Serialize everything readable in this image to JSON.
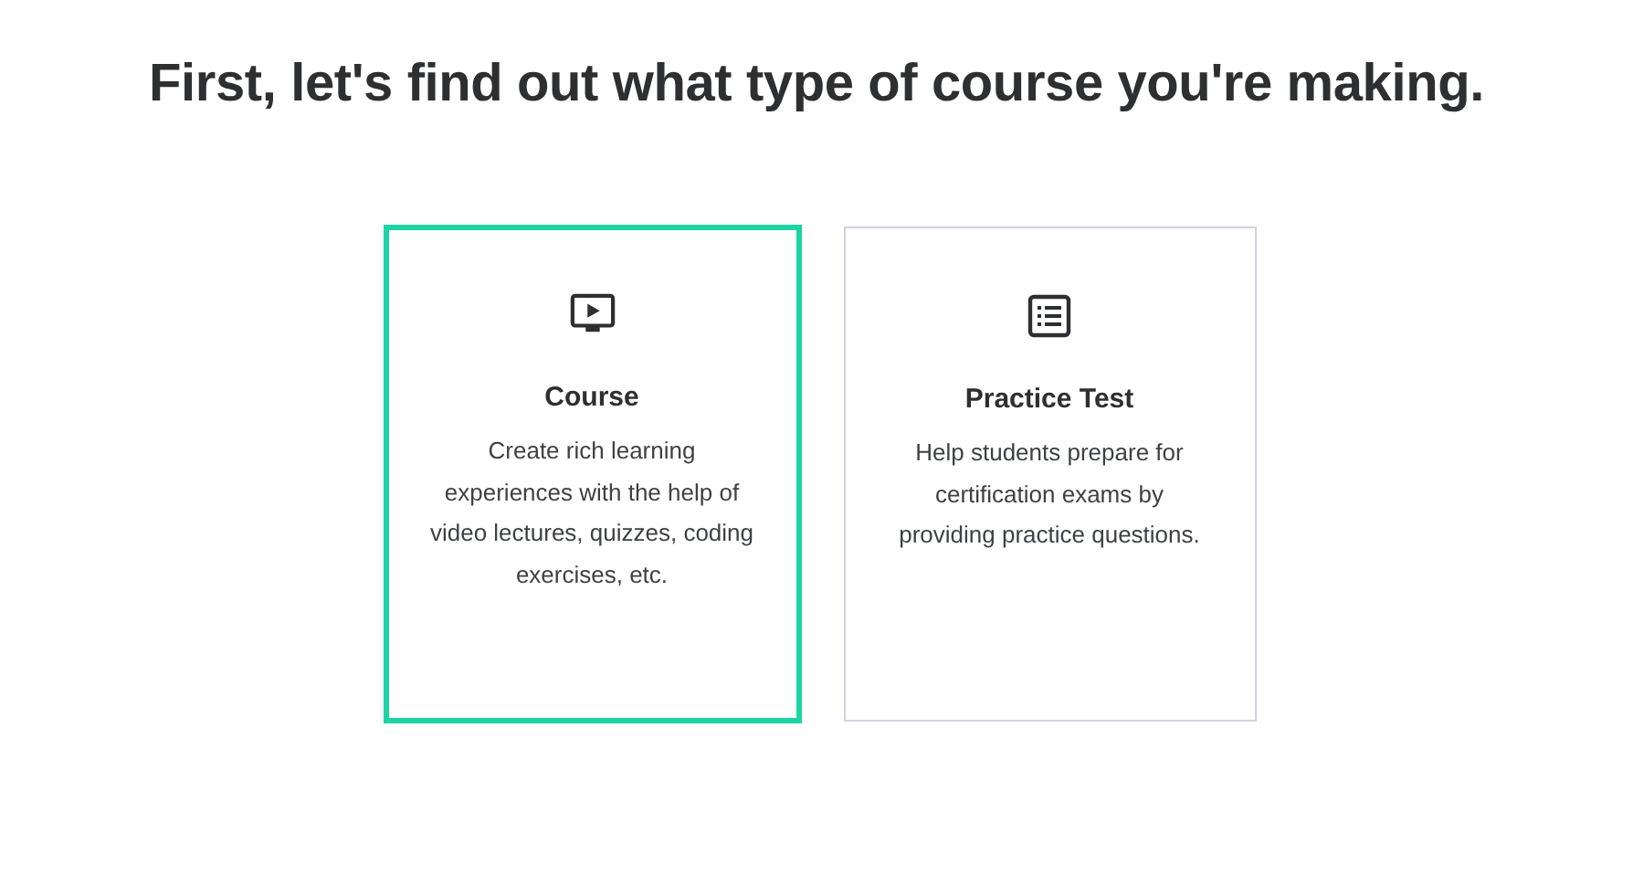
{
  "heading": "First, let's find out what type of course you're making.",
  "options": [
    {
      "kind": "video",
      "title": "Course",
      "description_lines": [
        "Create rich learning",
        "experiences with the help of",
        "video lectures, quizzes, coding",
        "exercises, etc."
      ],
      "selected": true
    },
    {
      "kind": "list",
      "title": "Practice Test",
      "description_lines": [
        "Help students prepare for",
        "certification exams by",
        "providing practice questions."
      ],
      "selected": false
    }
  ]
}
